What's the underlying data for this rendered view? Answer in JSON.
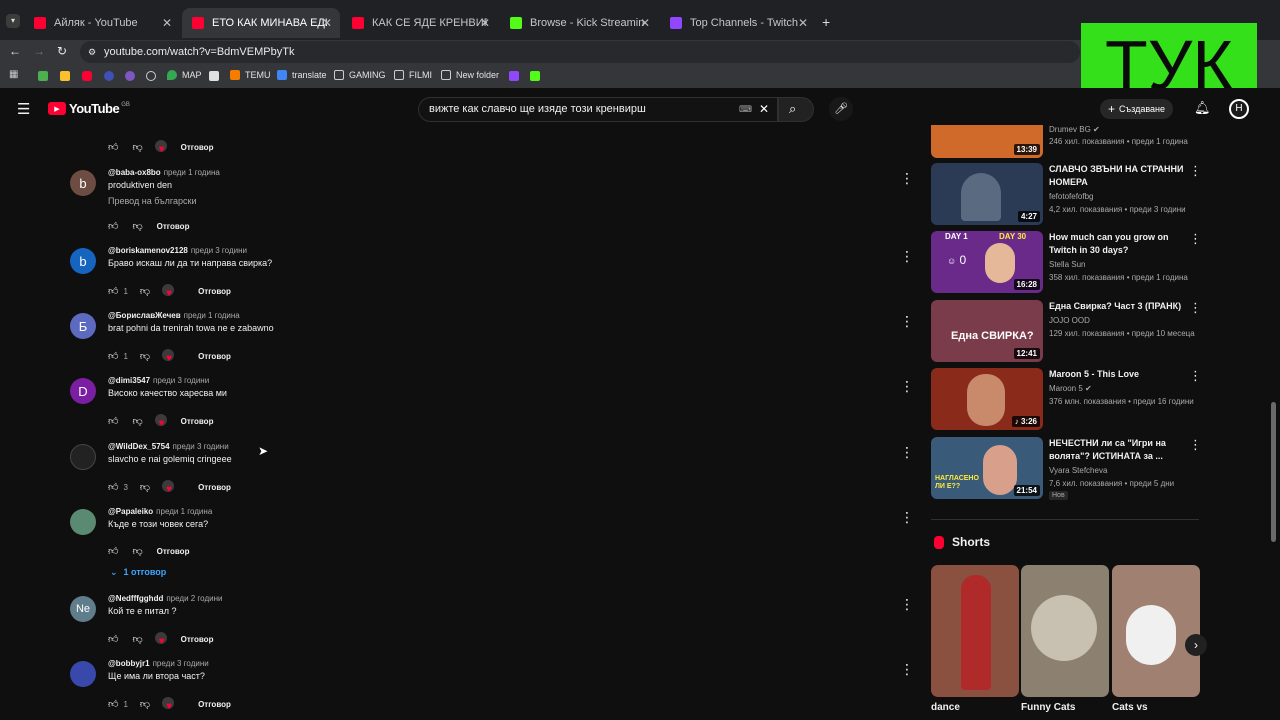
{
  "browser": {
    "tabs": [
      {
        "title": "Айляк - YouTube",
        "active": false
      },
      {
        "title": "ЕТО КАК МИНАВА ЕДИН ДЕН",
        "active": true
      },
      {
        "title": "КАК СЕ ЯДЕ КРЕНВИРШ | Нед",
        "active": false
      },
      {
        "title": "Browse - Kick Streaming",
        "active": false
      },
      {
        "title": "Top Channels - Twitch",
        "active": false
      }
    ],
    "new_tab": "+",
    "url": "youtube.com/watch?v=BdmVEMPbyTk",
    "bookmarks": [
      "MAP",
      "TEMU",
      "translate",
      "GAMING",
      "FILMI",
      "New folder"
    ]
  },
  "overlay_text": "ТУК",
  "youtube": {
    "logo": "YouTube",
    "region": "GB",
    "search_query": "вижте как славчо ще изяде този кренвирш",
    "create_label": "Създаване",
    "avatar_letter": "Н"
  },
  "comments": [
    {
      "user": "@baba-ox8bo",
      "time": "преди 1 година",
      "text": "produktiven den",
      "translate": "Превод на български",
      "likes": "",
      "avatar_letter": "b",
      "avatar_color": "#6d4c41",
      "heart": false,
      "reply": "Отговор"
    },
    {
      "user": "@boriskamenov2128",
      "time": "преди 3 години",
      "text": "Браво искаш ли да ти направа свирка?",
      "likes": "1",
      "avatar_letter": "b",
      "avatar_color": "#1565c0",
      "heart": true,
      "reply": "Отговор"
    },
    {
      "user": "@БориславЖечев",
      "time": "преди 1 година",
      "text": "brat pohni da trenirah towa ne e zabawno",
      "likes": "1",
      "avatar_letter": "Б",
      "avatar_color": "#5c6bc0",
      "heart": true,
      "reply": "Отговор"
    },
    {
      "user": "@dimi3547",
      "time": "преди 3 години",
      "text": "Високо качество харесва ми",
      "likes": "",
      "avatar_letter": "D",
      "avatar_color": "#7b1fa2",
      "heart": true,
      "reply": "Отговор"
    },
    {
      "user": "@WildDex_5754",
      "time": "преди 3 години",
      "text": "slavcho e nai golemiq cringeee",
      "likes": "3",
      "avatar_letter": "",
      "avatar_color": "#222222",
      "heart": true,
      "reply": "Отговор"
    },
    {
      "user": "@Papaleiko",
      "time": "преди 1 година",
      "text": "Къде е този човек сега?",
      "likes": "",
      "avatar_letter": "",
      "avatar_color": "#5b8a72",
      "heart": false,
      "reply": "Отговор"
    },
    {
      "user": "@Nedfffgghdd",
      "time": "преди 2 години",
      "text": "Кой те е питал ?",
      "likes": "",
      "avatar_letter": "Ne",
      "avatar_color": "#607d8b",
      "heart": true,
      "reply": "Отговор"
    },
    {
      "user": "@bobbyjr1",
      "time": "преди 3 години",
      "text": "Ще има ли втора част?",
      "likes": "1",
      "avatar_letter": "",
      "avatar_color": "#3949ab",
      "heart": true,
      "reply": "Отговор"
    }
  ],
  "replies_toggle": "1 отговор",
  "top_partial": {
    "likes_label": "Отговор"
  },
  "sidebar": {
    "partial": {
      "channel": "Drumev BG",
      "meta": "246 хил. показвания • преди 1 година",
      "duration": "13:39"
    },
    "videos": [
      {
        "title": "СЛАВЧО ЗВЪНИ НА СТРАННИ НОМЕРА",
        "channel": "fefotofefofbg",
        "meta": "4,2 хил. показвания • преди 3 години",
        "duration": "4:27",
        "thumb_color": "#2b3b55"
      },
      {
        "title": "How much can you grow on Twitch in 30 days?",
        "channel": "Stella Sun",
        "meta": "358 хил. показвания • преди 1 година",
        "duration": "16:28",
        "thumb_color": "#6a2a8a",
        "day1": "DAY 1",
        "day30": "DAY 30",
        "viewers": "0"
      },
      {
        "title": "Една Свирка? Част 3 (ПРАНК)",
        "channel": "JOJO OOD",
        "meta": "129 хил. показвания • преди 10 месеца",
        "duration": "12:41",
        "thumb_color": "#7a3b4a",
        "caption": "Една СВИРКА?"
      },
      {
        "title": "Maroon 5 - This Love",
        "channel": "Maroon 5",
        "meta": "376 млн. показвания • преди 16 години",
        "duration": "3:26",
        "thumb_color": "#8a2a1a"
      },
      {
        "title": "НЕЧЕСТНИ ли са \"Игри на волята\"? ИСТИНАТА за ...",
        "channel": "Vyara Stefcheva",
        "meta": "7,6 хил. показвания • преди 5 дни",
        "duration": "21:54",
        "thumb_color": "#3a5a7a",
        "badge": "Нов",
        "caption": "НАГЛАСЕНО ЛИ Е??"
      }
    ]
  },
  "shorts": {
    "heading": "Shorts",
    "items": [
      {
        "label": "dance",
        "color": "#8a5040"
      },
      {
        "label": "Funny Cats",
        "color": "#8c8070"
      },
      {
        "label": "Cats vs",
        "color": "#a08070"
      }
    ]
  }
}
